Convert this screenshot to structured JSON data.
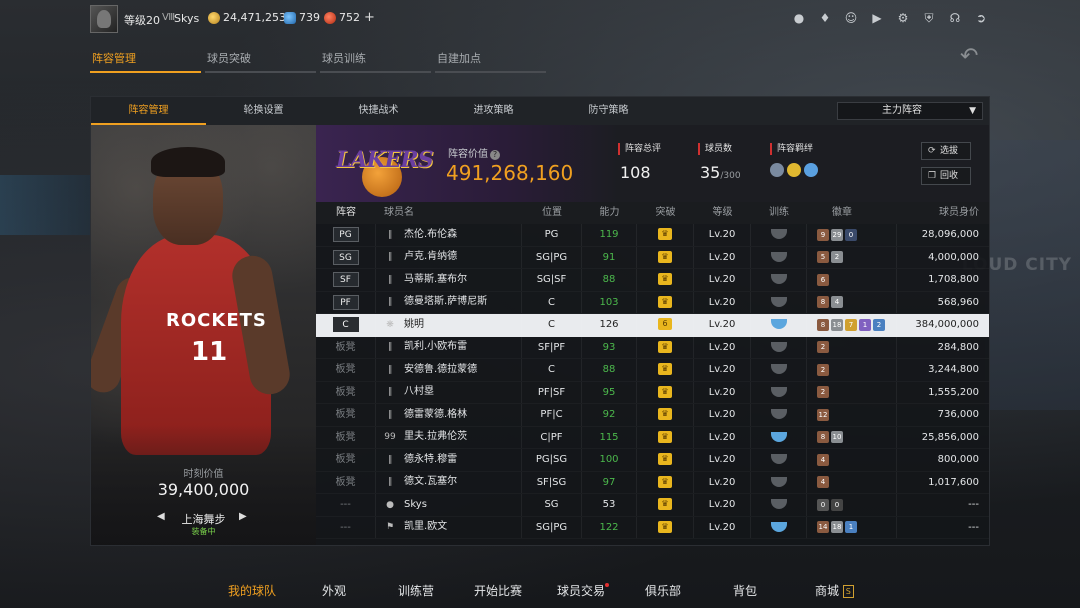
{
  "topbar": {
    "level": "等级20",
    "rank": "Ⅷ",
    "username": "Skys",
    "gold": "24,471,253",
    "points": "739",
    "diamonds": "752",
    "plus": "+",
    "icons": [
      "user-icon",
      "bell-icon",
      "friends-icon",
      "video-icon",
      "gear-icon",
      "shield-icon",
      "headset-icon",
      "exit-icon"
    ]
  },
  "main_tabs": [
    {
      "label": "阵容管理",
      "active": true
    },
    {
      "label": "球员突破",
      "active": false
    },
    {
      "label": "球员训练",
      "active": false
    },
    {
      "label": "自建加点",
      "active": false
    }
  ],
  "sub_tabs": [
    {
      "label": "阵容管理",
      "active": true
    },
    {
      "label": "轮换设置",
      "active": false
    },
    {
      "label": "快捷战术",
      "active": false
    },
    {
      "label": "进攻策略",
      "active": false
    },
    {
      "label": "防守策略",
      "active": false
    }
  ],
  "lineup_select": {
    "value": "主力阵容"
  },
  "player_card": {
    "jersey": "ROCKETS",
    "number": "11",
    "price_label": "时刻价值",
    "price_value": "39,400,000",
    "move": "上海舞步",
    "move_status": "装备中"
  },
  "team": {
    "logo_text": "LAKERS",
    "value_label": "阵容价值",
    "value": "491,268,160",
    "overall_label": "阵容总评",
    "overall": "108",
    "count_label": "球员数",
    "count": "35",
    "count_max": "/300",
    "bond_label": "阵容羁绊",
    "btn_select": "选拔",
    "btn_recycle": "回收"
  },
  "columns": [
    "阵容",
    "球员名",
    "位置",
    "能力",
    "突破",
    "等级",
    "训练",
    "徽章",
    "球员身价"
  ],
  "rows": [
    {
      "slot": "PG",
      "name": "杰伦.布伦森",
      "pos": "PG",
      "rating": "119",
      "brk": "",
      "lvl": "Lv.20",
      "train": "gray",
      "badges": [
        {
          "t": "9",
          "c": "#8a5a40"
        },
        {
          "t": "29",
          "c": "#8a8e92"
        },
        {
          "t": "0",
          "c": "#3a4a6a"
        }
      ],
      "price": "28,096,000",
      "bench": false,
      "sel": false,
      "icon": "signal"
    },
    {
      "slot": "SG",
      "name": "卢克.肯纳德",
      "pos": "SG|PG",
      "rating": "91",
      "brk": "",
      "lvl": "Lv.20",
      "train": "gray",
      "badges": [
        {
          "t": "5",
          "c": "#8a5a40"
        },
        {
          "t": "2",
          "c": "#8a8e92"
        }
      ],
      "price": "4,000,000",
      "bench": false,
      "sel": false,
      "icon": "signal"
    },
    {
      "slot": "SF",
      "name": "马蒂斯.塞布尔",
      "pos": "SG|SF",
      "rating": "88",
      "brk": "",
      "lvl": "Lv.20",
      "train": "gray",
      "badges": [
        {
          "t": "6",
          "c": "#8a5a40"
        }
      ],
      "price": "1,708,800",
      "bench": false,
      "sel": false,
      "icon": "signal"
    },
    {
      "slot": "PF",
      "name": "德曼塔斯.萨博尼斯",
      "pos": "C",
      "rating": "103",
      "brk": "",
      "lvl": "Lv.20",
      "train": "gray",
      "badges": [
        {
          "t": "8",
          "c": "#8a5a40"
        },
        {
          "t": "4",
          "c": "#8a8e92"
        }
      ],
      "price": "568,960",
      "bench": false,
      "sel": false,
      "icon": "signal"
    },
    {
      "slot": "C",
      "name": "姚明",
      "pos": "C",
      "rating": "126",
      "brk": "6",
      "lvl": "Lv.20",
      "train": "blue",
      "badges": [
        {
          "t": "8",
          "c": "#8a5a40"
        },
        {
          "t": "18",
          "c": "#8a8e92"
        },
        {
          "t": "7",
          "c": "#d0a030"
        },
        {
          "t": "1",
          "c": "#8060c0"
        },
        {
          "t": "2",
          "c": "#4a80c0"
        }
      ],
      "price": "384,000,000",
      "bench": false,
      "sel": true,
      "icon": "star"
    },
    {
      "slot": "板凳",
      "name": "凯利.小欧布雷",
      "pos": "SF|PF",
      "rating": "93",
      "brk": "",
      "lvl": "Lv.20",
      "train": "gray",
      "badges": [
        {
          "t": "2",
          "c": "#8a5a40"
        }
      ],
      "price": "284,800",
      "bench": true,
      "sel": false,
      "icon": "signal"
    },
    {
      "slot": "板凳",
      "name": "安德鲁.德拉蒙德",
      "pos": "C",
      "rating": "88",
      "brk": "",
      "lvl": "Lv.20",
      "train": "gray",
      "badges": [
        {
          "t": "2",
          "c": "#8a5a40"
        }
      ],
      "price": "3,244,800",
      "bench": true,
      "sel": false,
      "icon": "signal"
    },
    {
      "slot": "板凳",
      "name": "八村塁",
      "pos": "PF|SF",
      "rating": "95",
      "brk": "",
      "lvl": "Lv.20",
      "train": "gray",
      "badges": [
        {
          "t": "2",
          "c": "#8a5a40"
        }
      ],
      "price": "1,555,200",
      "bench": true,
      "sel": false,
      "icon": "signal"
    },
    {
      "slot": "板凳",
      "name": "德雷蒙德.格林",
      "pos": "PF|C",
      "rating": "92",
      "brk": "",
      "lvl": "Lv.20",
      "train": "gray",
      "badges": [
        {
          "t": "12",
          "c": "#8a5a40"
        }
      ],
      "price": "736,000",
      "bench": true,
      "sel": false,
      "icon": "signal"
    },
    {
      "slot": "板凳",
      "name": "里夫.拉弗伦茨",
      "pos": "C|PF",
      "rating": "115",
      "brk": "",
      "lvl": "Lv.20",
      "train": "blue",
      "badges": [
        {
          "t": "8",
          "c": "#8a5a40"
        },
        {
          "t": "10",
          "c": "#8a8e92"
        }
      ],
      "price": "25,856,000",
      "bench": true,
      "sel": false,
      "icon": "99"
    },
    {
      "slot": "板凳",
      "name": "德永特.穆雷",
      "pos": "PG|SG",
      "rating": "100",
      "brk": "",
      "lvl": "Lv.20",
      "train": "gray",
      "badges": [
        {
          "t": "4",
          "c": "#8a5a40"
        }
      ],
      "price": "800,000",
      "bench": true,
      "sel": false,
      "icon": "signal"
    },
    {
      "slot": "板凳",
      "name": "德文.瓦塞尔",
      "pos": "SF|SG",
      "rating": "97",
      "brk": "",
      "lvl": "Lv.20",
      "train": "gray",
      "badges": [
        {
          "t": "4",
          "c": "#8a5a40"
        }
      ],
      "price": "1,017,600",
      "bench": true,
      "sel": false,
      "icon": "signal"
    },
    {
      "slot": "---",
      "name": "Skys",
      "pos": "SG",
      "rating": "53",
      "brk": "",
      "lvl": "Lv.20",
      "train": "gray",
      "badges": [
        {
          "t": "0",
          "c": "#555"
        },
        {
          "t": "0",
          "c": "#444"
        }
      ],
      "price": "---",
      "bench": true,
      "sel": false,
      "icon": "person",
      "white_rating": true
    },
    {
      "slot": "---",
      "name": "凯里.欧文",
      "pos": "SG|PG",
      "rating": "122",
      "brk": "",
      "lvl": "Lv.20",
      "train": "blue",
      "badges": [
        {
          "t": "14",
          "c": "#8a5a40"
        },
        {
          "t": "18",
          "c": "#8a8e92"
        },
        {
          "t": "1",
          "c": "#4a80c0"
        }
      ],
      "price": "---",
      "bench": true,
      "sel": false,
      "icon": "pin"
    }
  ],
  "bottom_nav": [
    {
      "label": "我的球队",
      "active": true
    },
    {
      "label": "外观",
      "active": false
    },
    {
      "label": "训练营",
      "active": false
    },
    {
      "label": "开始比赛",
      "active": false
    },
    {
      "label": "球员交易",
      "active": false,
      "dot": true
    },
    {
      "label": "俱乐部",
      "active": false
    },
    {
      "label": "背包",
      "active": false
    },
    {
      "label": "商城",
      "active": false,
      "shop": true
    }
  ],
  "colors": {
    "accent": "#f0a020",
    "rating": "#4cb84c",
    "panel": "#141619"
  }
}
